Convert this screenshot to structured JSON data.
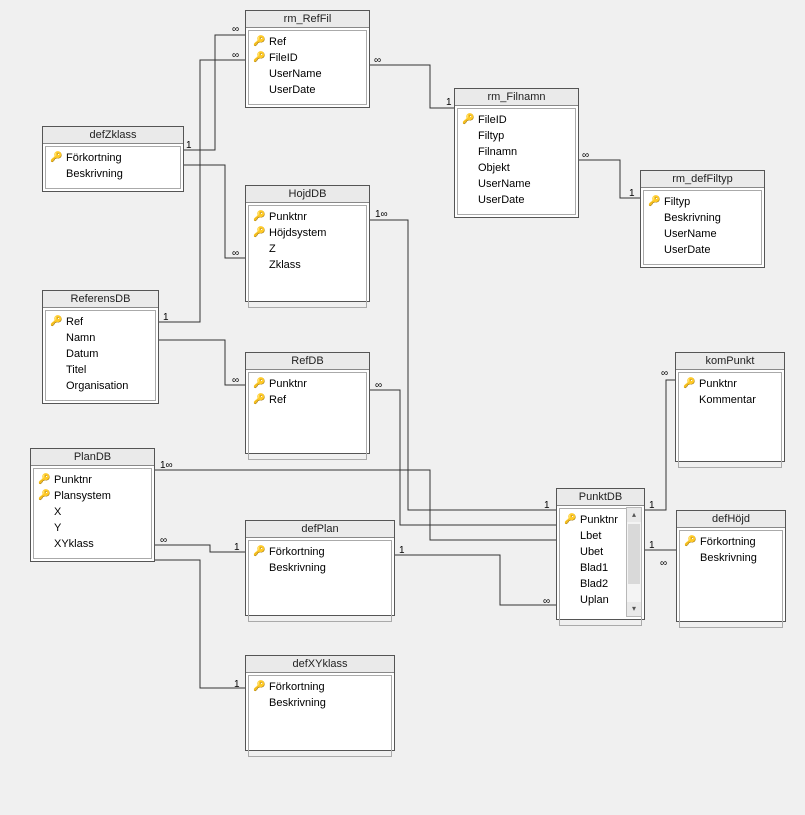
{
  "tables": {
    "defZklass": {
      "name": "defZklass",
      "fields": [
        "Förkortning",
        "Beskrivning"
      ]
    },
    "ReferensDB": {
      "name": "ReferensDB",
      "fields": [
        "Ref",
        "Namn",
        "Datum",
        "Titel",
        "Organisation"
      ]
    },
    "PlanDB": {
      "name": "PlanDB",
      "fields": [
        "Punktnr",
        "Plansystem",
        "X",
        "Y",
        "XYklass"
      ]
    },
    "rm_RefFil": {
      "name": "rm_RefFil",
      "fields": [
        "Ref",
        "FileID",
        "UserName",
        "UserDate"
      ]
    },
    "HojdDB": {
      "name": "HojdDB",
      "fields": [
        "Punktnr",
        "Höjdsystem",
        "Z",
        "Zklass"
      ]
    },
    "RefDB": {
      "name": "RefDB",
      "fields": [
        "Punktnr",
        "Ref"
      ]
    },
    "defPlan": {
      "name": "defPlan",
      "fields": [
        "Förkortning",
        "Beskrivning"
      ]
    },
    "defXYklass": {
      "name": "defXYklass",
      "fields": [
        "Förkortning",
        "Beskrivning"
      ]
    },
    "rm_Filnamn": {
      "name": "rm_Filnamn",
      "fields": [
        "FileID",
        "Filtyp",
        "Filnamn",
        "Objekt",
        "UserName",
        "UserDate"
      ]
    },
    "rm_defFiltyp": {
      "name": "rm_defFiltyp",
      "fields": [
        "Filtyp",
        "Beskrivning",
        "UserName",
        "UserDate"
      ]
    },
    "PunktDB": {
      "name": "PunktDB",
      "fields": [
        "Punktnr",
        "Lbet",
        "Ubet",
        "Blad1",
        "Blad2",
        "Uplan"
      ]
    },
    "komPunkt": {
      "name": "komPunkt",
      "fields": [
        "Punktnr",
        "Kommentar"
      ]
    },
    "defHojd": {
      "name": "defHöjd",
      "fields": [
        "Förkortning",
        "Beskrivning"
      ]
    }
  },
  "relationships": [
    {
      "from": "defZklass",
      "to": "rm_RefFil",
      "card_from": "1",
      "card_to": "∞"
    },
    {
      "from": "defZklass",
      "to": "HojdDB",
      "card_from": "1",
      "card_to": "∞"
    },
    {
      "from": "ReferensDB",
      "to": "rm_RefFil",
      "card_from": "1",
      "card_to": "∞"
    },
    {
      "from": "ReferensDB",
      "to": "RefDB",
      "card_from": "1",
      "card_to": "∞"
    },
    {
      "from": "rm_RefFil",
      "to": "rm_Filnamn",
      "card_from": "∞",
      "card_to": "1"
    },
    {
      "from": "rm_Filnamn",
      "to": "rm_defFiltyp",
      "card_from": "∞",
      "card_to": "1"
    },
    {
      "from": "HojdDB",
      "to": "PunktDB",
      "card_from": "1∞",
      "card_to": "1"
    },
    {
      "from": "RefDB",
      "to": "PunktDB",
      "card_from": "∞",
      "card_to": "1"
    },
    {
      "from": "PlanDB",
      "to": "PunktDB",
      "card_from": "1∞",
      "card_to": "1"
    },
    {
      "from": "PlanDB",
      "to": "defPlan",
      "card_from": "∞",
      "card_to": "1"
    },
    {
      "from": "PlanDB",
      "to": "defXYklass",
      "card_from": "∞",
      "card_to": "1"
    },
    {
      "from": "defPlan",
      "to": "PunktDB",
      "card_from": "1",
      "card_to": "∞"
    },
    {
      "from": "PunktDB",
      "to": "komPunkt",
      "card_from": "1",
      "card_to": "∞"
    },
    {
      "from": "PunktDB",
      "to": "defHöjd",
      "card_from": "1",
      "card_to": "∞"
    }
  ]
}
